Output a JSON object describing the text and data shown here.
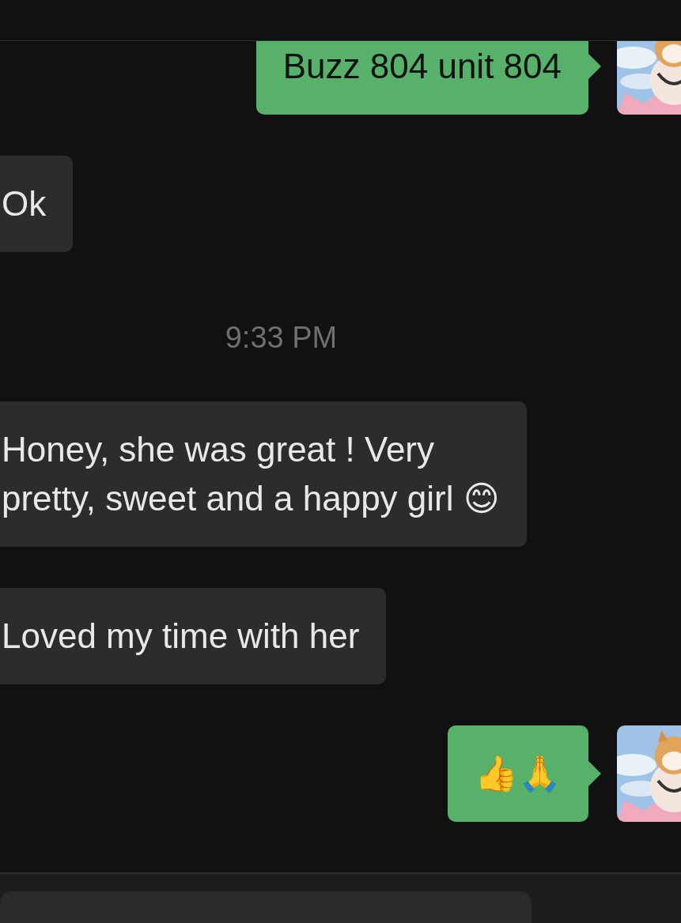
{
  "messages": [
    {
      "kind": "outgoing",
      "text": "Buzz 804 unit 804"
    },
    {
      "kind": "incoming",
      "text": "Ok"
    },
    {
      "kind": "time",
      "text": "9:33 PM"
    },
    {
      "kind": "incoming",
      "text": "Honey, she was great ! Very pretty, sweet and a happy girl 😊"
    },
    {
      "kind": "incoming",
      "text": "Loved my time with her"
    },
    {
      "kind": "outgoing",
      "text": "👍🙏"
    }
  ]
}
